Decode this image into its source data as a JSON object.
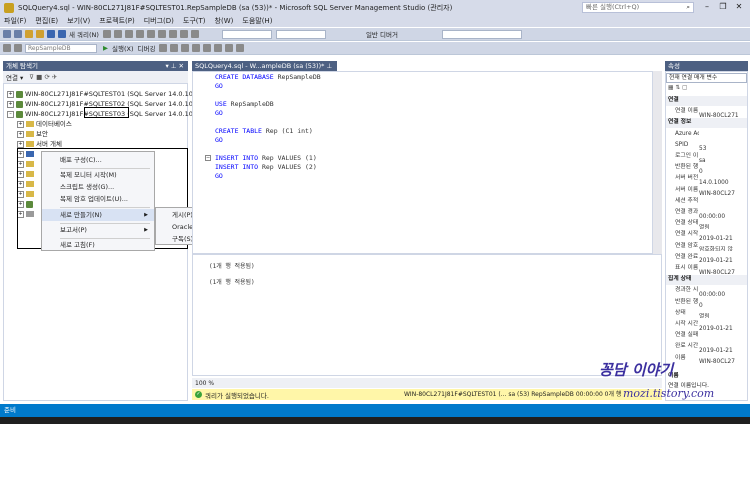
{
  "window": {
    "title": "SQLQuery4.sql - WIN-80CL271J81F#SQLTEST01.RepSampleDB (sa (53))* - Microsoft SQL Server Management Studio (관리자)",
    "quick_launch_placeholder": "빠른 실행(Ctrl+Q)"
  },
  "menu": [
    "파일(F)",
    "편집(E)",
    "보기(V)",
    "프로젝트(P)",
    "디버그(D)",
    "도구(T)",
    "창(W)",
    "도움말(H)"
  ],
  "toolbar": {
    "new_query": "새 쿼리(N)",
    "db_combo": "RepSampleDB",
    "execute": "실행(X)",
    "debug": "디버깅",
    "solution": "일반 디버거"
  },
  "object_explorer": {
    "title": "개체 탐색기",
    "connect_label": "연결 ▾",
    "servers": [
      "WIN-80CL271J81F#SQLTEST01 (SQL Server 14.0.100",
      "WIN-80CL271J81F#SQLTEST02 (SQL Server 14.0.100",
      "WIN-80CL271J81F#SQLTEST03 (SQL Server 14.0.100"
    ],
    "folders": [
      "데이터베이스",
      "보안",
      "서버 개체",
      "복제"
    ]
  },
  "context_menu": {
    "items": [
      "배포 구성(C)...",
      "복제 모니터 시작(M)",
      "스크립트 생성(G)...",
      "복제 암호 업데이트(U)...",
      "새로 만들기(N)",
      "보고서(P)",
      "새로 고침(F)"
    ],
    "submenu": [
      "게시(P)...",
      "Oracle 게시(O)...",
      "구독(S)..."
    ]
  },
  "editor": {
    "tab": "SQLQuery4.sql - W...ampleDB (sa (53))*",
    "lines": [
      {
        "kw": "CREATE DATABASE",
        "tx": " RepSampleDB"
      },
      {
        "kw": "GO",
        "tx": ""
      },
      {
        "kw": "",
        "tx": ""
      },
      {
        "kw": "USE",
        "tx": " RepSampleDB"
      },
      {
        "kw": "GO",
        "tx": ""
      },
      {
        "kw": "",
        "tx": ""
      },
      {
        "kw": "CREATE TABLE",
        "tx": " Rep (C1 int)"
      },
      {
        "kw": "GO",
        "tx": ""
      },
      {
        "kw": "",
        "tx": ""
      },
      {
        "kw": "INSERT INTO",
        "tx": " Rep VALUES (1)"
      },
      {
        "kw": "INSERT INTO",
        "tx": " Rep VALUES (2)"
      },
      {
        "kw": "GO",
        "tx": ""
      }
    ],
    "messages": [
      "(1개 행 적용됨)",
      "(1개 행 적용됨)"
    ],
    "zoom": "100 %"
  },
  "query_status": {
    "text": "쿼리가 실행되었습니다.",
    "context": "WIN-80CL271J81F#SQLTEST01 (... sa (53) RepSampleDB 00:00:00 0개 행"
  },
  "properties": {
    "title": "속성",
    "combo": "현재 연결 매개 변수",
    "rows": [
      {
        "type": "cat",
        "k": "연결"
      },
      {
        "type": "kv",
        "k": "연결 이름",
        "v": "WIN-80CL271"
      },
      {
        "type": "cat",
        "k": "연결 정보"
      },
      {
        "type": "kv",
        "k": "Azure Ac",
        "v": ""
      },
      {
        "type": "kv",
        "k": "SPID",
        "v": "53"
      },
      {
        "type": "kv",
        "k": "로그인 이",
        "v": "sa"
      },
      {
        "type": "kv",
        "k": "반환된 행",
        "v": "0"
      },
      {
        "type": "kv",
        "k": "서버 버전",
        "v": "14.0.1000"
      },
      {
        "type": "kv",
        "k": "서버 이름",
        "v": "WIN-80CL27"
      },
      {
        "type": "kv",
        "k": "세션 추적",
        "v": ""
      },
      {
        "type": "kv",
        "k": "연결 경과",
        "v": "00:00:00"
      },
      {
        "type": "kv",
        "k": "연결 상태",
        "v": "열림"
      },
      {
        "type": "kv",
        "k": "연결 시작",
        "v": "2019-01-21"
      },
      {
        "type": "kv",
        "k": "연결 암호",
        "v": "암호화되지 않"
      },
      {
        "type": "kv",
        "k": "연결 완료",
        "v": "2019-01-21"
      },
      {
        "type": "kv",
        "k": "표시 이름",
        "v": "WIN-80CL27"
      },
      {
        "type": "cat",
        "k": "집계 상태"
      },
      {
        "type": "kv",
        "k": "경과한 시",
        "v": "00:00:00"
      },
      {
        "type": "kv",
        "k": "반환된 행",
        "v": "0"
      },
      {
        "type": "kv",
        "k": "상태",
        "v": "열림"
      },
      {
        "type": "kv",
        "k": "시작 시간",
        "v": "2019-01-21"
      },
      {
        "type": "kv",
        "k": "연결 실패",
        "v": ""
      },
      {
        "type": "kv",
        "k": "완료 시간",
        "v": "2019-01-21"
      },
      {
        "type": "kv",
        "k": "이름",
        "v": "WIN-80CL27"
      }
    ],
    "footer_title": "이름",
    "footer_desc": "연결 이름입니다."
  },
  "statusbar": {
    "text": "준비"
  },
  "watermark": {
    "title": "꽁담 이야기",
    "url": "mozi.tistory.com"
  },
  "colors": {
    "accent": "#007acc",
    "panel_header": "#4d6082",
    "keyword": "#0000ff",
    "highlight": "#fff6a8"
  }
}
